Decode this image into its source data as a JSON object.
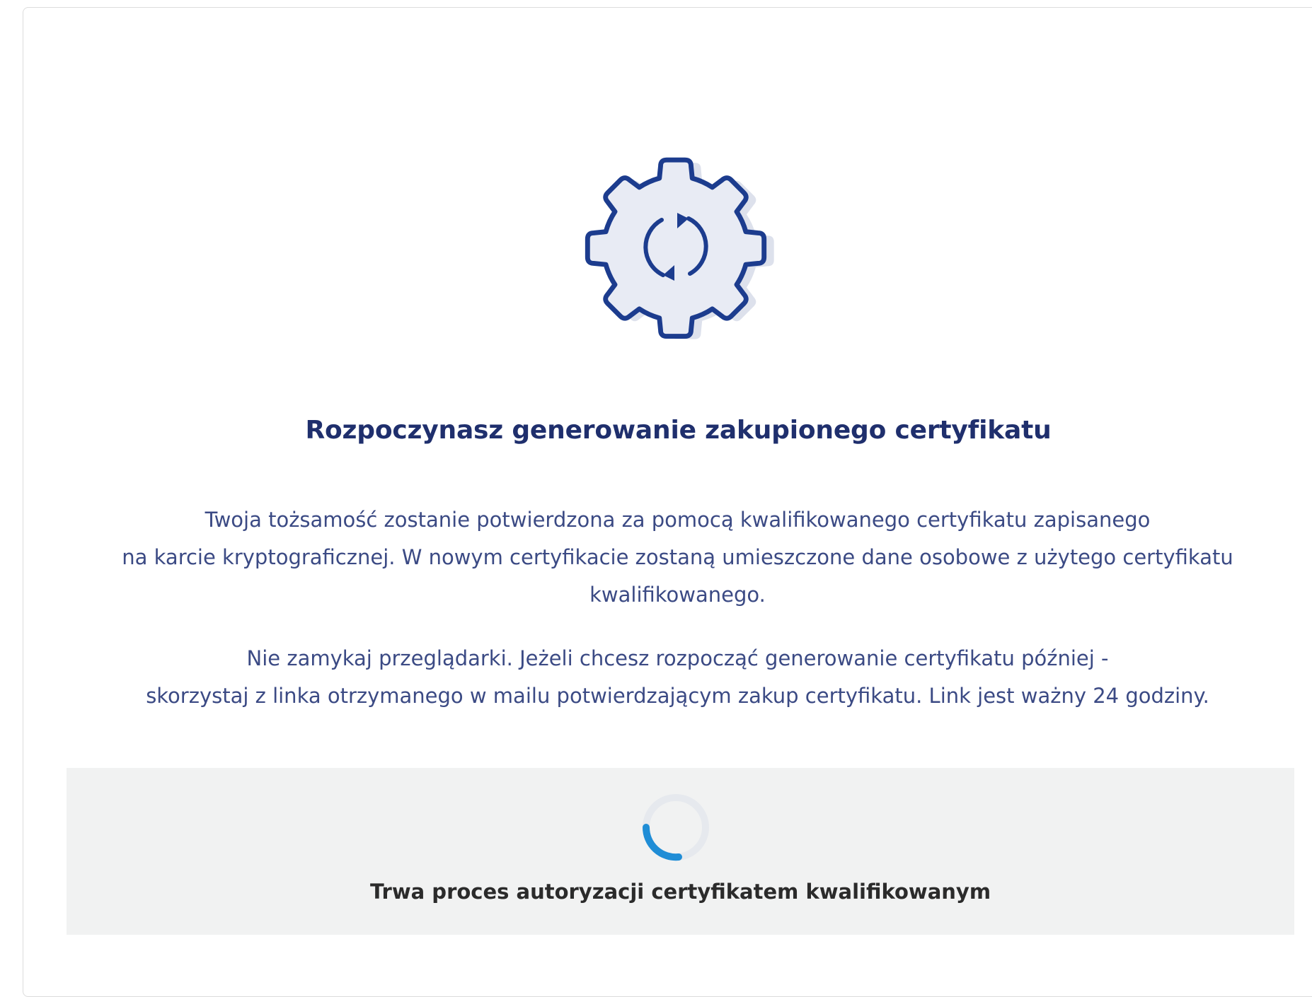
{
  "header": {
    "title": "Rozpoczynasz generowanie zakupionego certyfikatu"
  },
  "info": {
    "paragraph1": [
      "Twoja tożsamość zostanie potwierdzona za pomocą kwalifikowanego certyfikatu zapisanego",
      "na karcie kryptograficznej. W nowym certyfikacie zostaną umieszczone dane osobowe z użytego certyfikatu",
      "kwalifikowanego."
    ],
    "paragraph2": [
      "Nie zamykaj przeglądarki. Jeżeli chcesz rozpocząć generowanie certyfikatu później -",
      "skorzystaj z linka otrzymanego w mailu potwierdzającym zakup certyfikatu. Link jest ważny 24 godziny."
    ]
  },
  "status": {
    "text": "Trwa proces autoryzacji certyfikatem kwalifikowanym"
  },
  "icons": {
    "illustration": "gear-refresh-icon",
    "spinner": "loading-spinner-icon"
  },
  "colors": {
    "primary": "#1f2f6d",
    "gear_stroke": "#1c3c8e",
    "gear_fill": "#e8ebf4",
    "gear_shadow": "#dde1ec",
    "spinner_accent": "#1f8dd6",
    "spinner_track": "#e6e9ee",
    "panel_bg": "#f1f2f2",
    "body_text": "#3b4a84",
    "status_text": "#2b2b2b"
  }
}
